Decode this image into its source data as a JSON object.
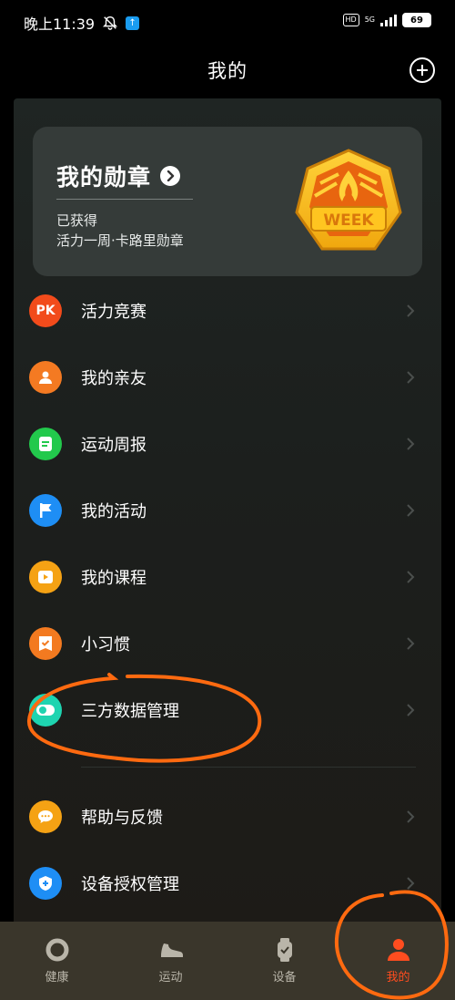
{
  "status_bar": {
    "time": "晚上11:39",
    "hd": "HD",
    "network": "5G",
    "battery": "69"
  },
  "header": {
    "title": "我的"
  },
  "medal_card": {
    "title": "我的勋章",
    "status": "已获得",
    "description": "活力一周·卡路里勋章",
    "badge_text": "WEEK"
  },
  "menu": {
    "items": [
      {
        "label": "活力竞赛",
        "icon": "pk-icon",
        "icon_text": "PK",
        "color": "#f24b1b"
      },
      {
        "label": "我的亲友",
        "icon": "person-icon",
        "color": "#f47a22"
      },
      {
        "label": "运动周报",
        "icon": "report-icon",
        "color": "#22c94c"
      },
      {
        "label": "我的活动",
        "icon": "flag-icon",
        "color": "#1e8ef5"
      },
      {
        "label": "我的课程",
        "icon": "play-icon",
        "color": "#f5a214"
      },
      {
        "label": "小习惯",
        "icon": "habit-check-icon",
        "color": "#f37a20"
      },
      {
        "label": "三方数据管理",
        "icon": "toggle-icon",
        "color": "#1ed4b0"
      },
      {
        "label": "帮助与反馈",
        "icon": "chat-icon",
        "color": "#f5a214"
      },
      {
        "label": "设备授权管理",
        "icon": "shield-icon",
        "color": "#1e8ef5"
      }
    ]
  },
  "bottom_nav": {
    "items": [
      {
        "label": "健康",
        "icon": "ring-icon"
      },
      {
        "label": "运动",
        "icon": "shoe-icon"
      },
      {
        "label": "设备",
        "icon": "watch-icon"
      },
      {
        "label": "我的",
        "icon": "profile-icon",
        "active": true
      }
    ]
  },
  "colors": {
    "accent": "#ff4d1f",
    "annotation": "#ff6a10"
  }
}
